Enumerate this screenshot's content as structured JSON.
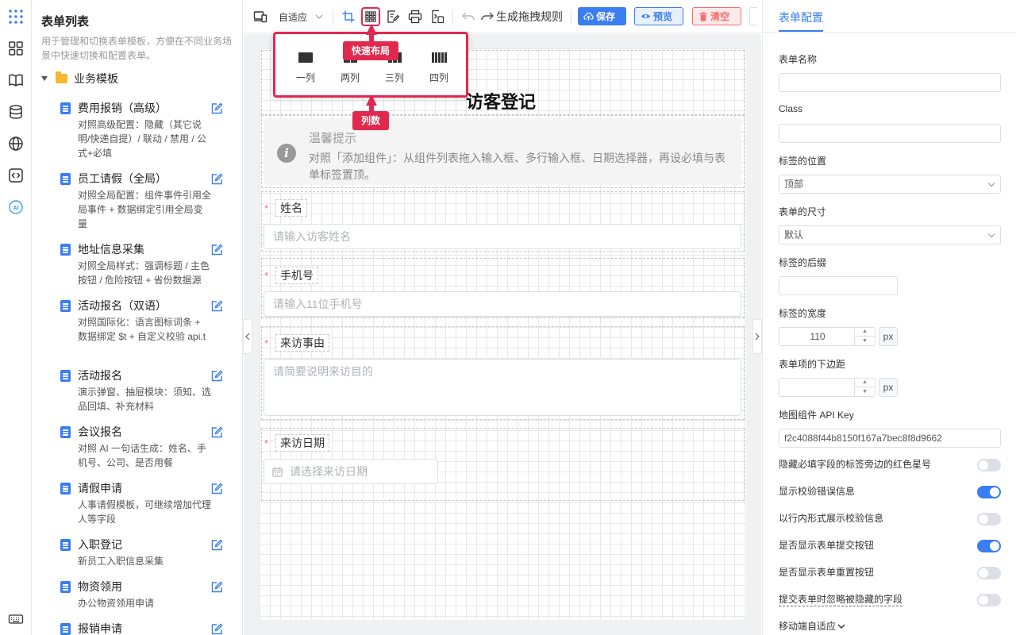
{
  "sidebar": {
    "title": "表单列表",
    "description": "用于管理和切换表单模板，方便在不同业务场景中快速切换和配置表单。",
    "folder_label": "业务模板",
    "items": [
      {
        "name": "费用报销（高级）",
        "desc": "对照高级配置：隐藏（其它说明/快递自提）/ 联动 / 禁用 / 公式+必填"
      },
      {
        "name": "员工请假（全局）",
        "desc": "对照全局配置：组件事件引用全局事件 + 数据绑定引用全局变量"
      },
      {
        "name": "地址信息采集",
        "desc": "对照全局样式：强调标题 / 主色按钮 / 危险按钮 + 省份数据源"
      },
      {
        "name": "活动报名（双语）",
        "desc": "对照国际化：语言图标词条 + 数据绑定 $t + 自定义校验 api.t"
      },
      {
        "name": "活动报名",
        "desc": "演示弹窗、抽屉模块：须知、选品回填、补充材料"
      },
      {
        "name": "会议报名",
        "desc": "对照 AI 一句话生成：姓名、手机号、公司、是否用餐"
      },
      {
        "name": "请假申请",
        "desc": "人事请假模板，可继续增加代理人等字段"
      },
      {
        "name": "入职登记",
        "desc": "新员工入职信息采集"
      },
      {
        "name": "物资领用",
        "desc": "办公物资领用申请"
      },
      {
        "name": "报销申请",
        "desc": ""
      }
    ]
  },
  "toolbar": {
    "adapt_label": "自适应",
    "gen_rules_label": "生成拖拽规则",
    "save_label": "保存",
    "preview_label": "预览",
    "clear_label": "清空"
  },
  "popup": {
    "options": [
      "一列",
      "两列",
      "三列",
      "四列"
    ],
    "tag_quick_layout": "快速布局",
    "tag_columns": "列数"
  },
  "form": {
    "title": "访客登记",
    "alert_title": "温馨提示",
    "alert_text": "对照「添加组件」：从组件列表拖入输入框、多行输入框、日期选择器，再设必填与表单标签置顶。",
    "fields": [
      {
        "label": "姓名",
        "placeholder": "请输入访客姓名"
      },
      {
        "label": "手机号",
        "placeholder": "请输入11位手机号"
      },
      {
        "label": "来访事由",
        "placeholder": "请简要说明来访目的"
      },
      {
        "label": "来访日期",
        "placeholder": "请选择来访日期"
      }
    ],
    "required_mark": "*"
  },
  "panel": {
    "tab": "表单配置",
    "form_name_label": "表单名称",
    "form_name_value": "",
    "class_label": "Class",
    "class_value": "",
    "label_pos_label": "标签的位置",
    "label_pos_value": "顶部",
    "form_size_label": "表单的尺寸",
    "form_size_value": "默认",
    "label_suffix_label": "标签的后缀",
    "label_suffix_value": "",
    "label_width_label": "标签的宽度",
    "label_width_value": "110",
    "unit_px": "px",
    "item_margin_label": "表单项的下边距",
    "item_margin_value": "",
    "map_key_label": "地图组件 API Key",
    "map_key_value": "f2c4088f44b8150f167a7bec8f8d9662",
    "switches": [
      {
        "label": "隐藏必填字段的标签旁边的红色星号",
        "on": false
      },
      {
        "label": "显示校验错误信息",
        "on": true
      },
      {
        "label": "以行内形式展示校验信息",
        "on": false
      },
      {
        "label": "是否显示表单提交按钮",
        "on": true
      },
      {
        "label": "是否显示表单重置按钮",
        "on": false
      },
      {
        "label": "提交表单时忽略被隐藏的字段",
        "on": false
      }
    ],
    "mobile_label": "移动端自适应"
  },
  "colors": {
    "primary": "#3a7ef2",
    "danger_tag": "#e1294f",
    "required": "#f56c6c"
  }
}
